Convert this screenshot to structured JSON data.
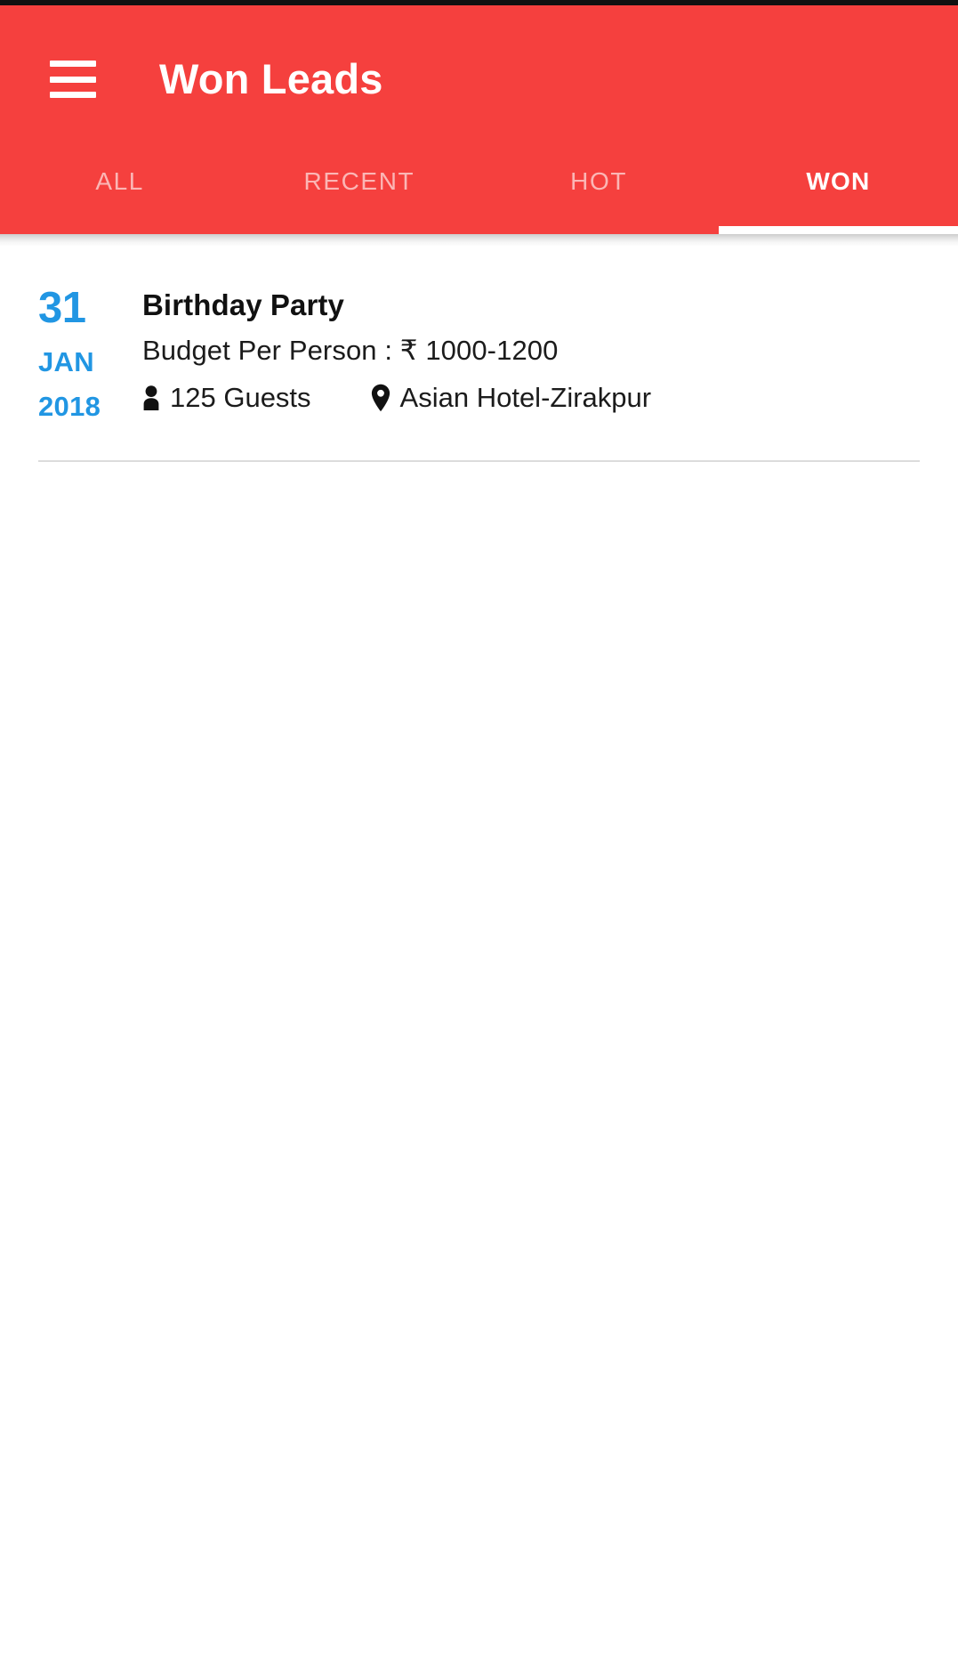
{
  "app": {
    "title": "Won Leads",
    "brand_color": "#f5403e",
    "accent_color": "#2196e3",
    "menu_icon": "hamburger-menu-icon"
  },
  "tabs": {
    "items": [
      {
        "id": "all",
        "label": "ALL",
        "active": false
      },
      {
        "id": "recent",
        "label": "RECENT",
        "active": false
      },
      {
        "id": "hot",
        "label": "HOT",
        "active": false
      },
      {
        "id": "won",
        "label": "WON",
        "active": true
      }
    ],
    "active_index": 3,
    "indicator_color": "#ffffff"
  },
  "leads": [
    {
      "date": {
        "day": "31",
        "month": "JAN",
        "year": "2018"
      },
      "title": "Birthday Party",
      "budget": "Budget Per Person : ₹ 1000-1200",
      "guests": {
        "icon": "person-icon",
        "text": "125 Guests"
      },
      "venue": {
        "icon": "map-pin-icon",
        "text": "Asian Hotel-Zirakpur"
      }
    }
  ]
}
